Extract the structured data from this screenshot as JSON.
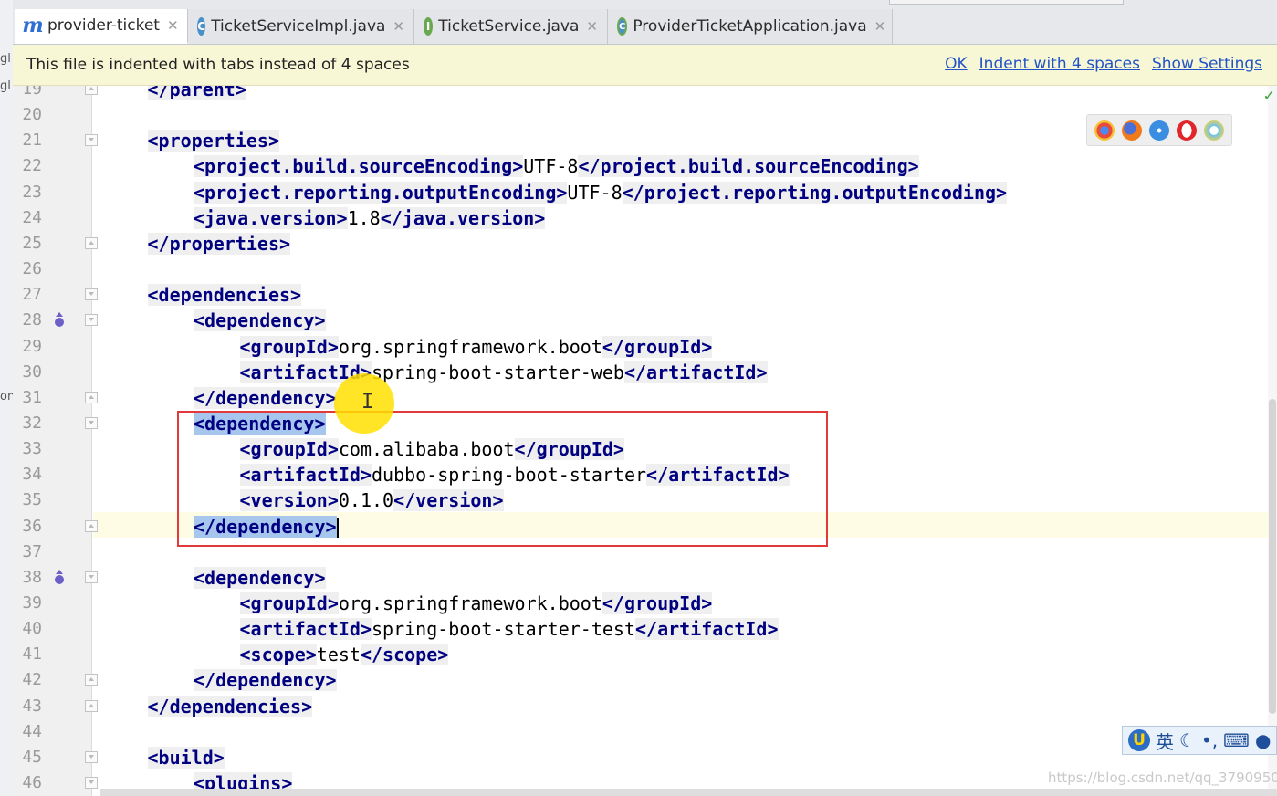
{
  "tabs": [
    {
      "label": "provider-ticket",
      "icon": "maven-m-icon",
      "active": true
    },
    {
      "label": "TicketServiceImpl.java",
      "icon": "class-c-icon"
    },
    {
      "label": "TicketService.java",
      "icon": "interface-i-icon"
    },
    {
      "label": "ProviderTicketApplication.java",
      "icon": "spring-app-icon"
    }
  ],
  "notice": {
    "message": "This file is indented with tabs instead of 4 spaces",
    "ok": "OK",
    "indent": "Indent with 4 spaces",
    "settings": "Show Settings"
  },
  "lines": [
    {
      "n": "19",
      "text": "</parent>"
    },
    {
      "n": "20",
      "text": ""
    },
    {
      "n": "21",
      "text": "<properties>"
    },
    {
      "n": "22",
      "text": "<project.build.sourceEncoding>UTF-8</project.build.sourceEncoding>"
    },
    {
      "n": "23",
      "text": "<project.reporting.outputEncoding>UTF-8</project.reporting.outputEncoding>"
    },
    {
      "n": "24",
      "text": "<java.version>1.8</java.version>"
    },
    {
      "n": "25",
      "text": "</properties>"
    },
    {
      "n": "26",
      "text": ""
    },
    {
      "n": "27",
      "text": "<dependencies>"
    },
    {
      "n": "28",
      "text": "<dependency>"
    },
    {
      "n": "29",
      "text": "<groupId>org.springframework.boot</groupId>"
    },
    {
      "n": "30",
      "text": "<artifactId>spring-boot-starter-web</artifactId>"
    },
    {
      "n": "31",
      "text": "</dependency>"
    },
    {
      "n": "32",
      "text": "<dependency>"
    },
    {
      "n": "33",
      "text": "<groupId>com.alibaba.boot</groupId>"
    },
    {
      "n": "34",
      "text": "<artifactId>dubbo-spring-boot-starter</artifactId>"
    },
    {
      "n": "35",
      "text": "<version>0.1.0</version>"
    },
    {
      "n": "36",
      "text": "</dependency>"
    },
    {
      "n": "37",
      "text": ""
    },
    {
      "n": "38",
      "text": "<dependency>"
    },
    {
      "n": "39",
      "text": "<groupId>org.springframework.boot</groupId>"
    },
    {
      "n": "40",
      "text": "<artifactId>spring-boot-starter-test</artifactId>"
    },
    {
      "n": "41",
      "text": "<scope>test</scope>"
    },
    {
      "n": "42",
      "text": "</dependency>"
    },
    {
      "n": "43",
      "text": "</dependencies>"
    },
    {
      "n": "44",
      "text": ""
    },
    {
      "n": "45",
      "text": "<build>"
    },
    {
      "n": "46",
      "text": "<plugins>"
    }
  ],
  "sliver": [
    "gl",
    "gl",
    "on"
  ],
  "ime": {
    "lang": "英"
  },
  "watermark": "https://blog.csdn.net/qq_37909508",
  "colors": {
    "tag": "#000080",
    "selection": "#a6c6ee",
    "highlight_box": "#e03a3a",
    "notice_bg": "#f8f7d5",
    "link": "#2153c6"
  }
}
